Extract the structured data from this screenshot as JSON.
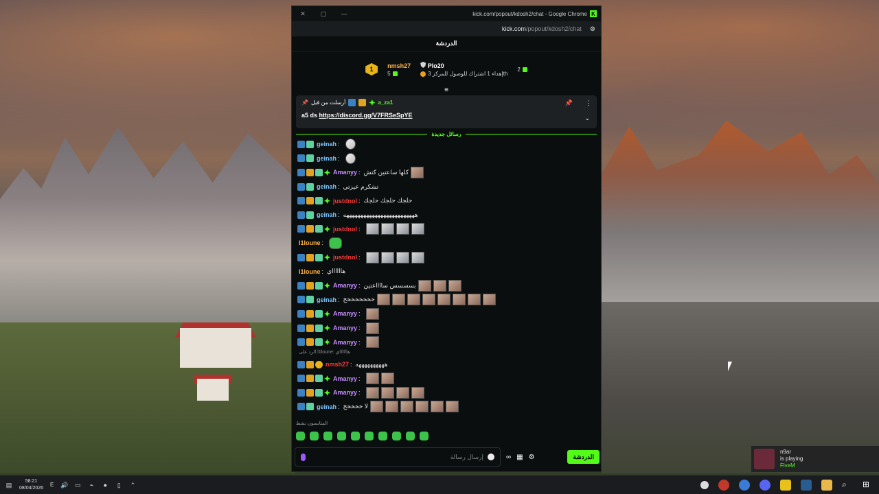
{
  "window": {
    "title": "kick.com/popout/kdosh2/chat - Google Chrome",
    "url_host": "kick.com",
    "url_path": "/popout/kdosh2/chat"
  },
  "chat_header": "الدردشة",
  "leaderboard": {
    "rank": "1",
    "first": {
      "name": "nmsh27",
      "count": "5"
    },
    "second": {
      "name": "Plo20",
      "sub": "إهداء 1 اشتراك للوصول للمركز 3th"
    },
    "right_count": "2"
  },
  "pinned": {
    "label": "أرسلت من قبل",
    "user": "a_za1",
    "text": "a5 ds",
    "link": "https://discord.gg/V7FRSeSpYE"
  },
  "new_messages_label": "رسائل جديدة",
  "messages": [
    {
      "user": "geinah",
      "color": "#7ec8ff",
      "text": ""
    },
    {
      "user": "geinah",
      "color": "#7ec8ff",
      "text": ""
    },
    {
      "user": "Amanyy",
      "color": "#c58cff",
      "text": "كلها ساعتين كتش"
    },
    {
      "user": "geinah",
      "color": "#7ec8ff",
      "text": "تشكرم عيزتي"
    },
    {
      "user": "justdnol",
      "color": "#ff3b3b",
      "text": "حلجك حلجك حلجك"
    },
    {
      "user": "geinah",
      "color": "#7ec8ff",
      "text": "هههههههههههههههههههههههههه"
    },
    {
      "user": "justdnol",
      "color": "#ff3b3b",
      "text": ""
    },
    {
      "user": "l1loune",
      "color": "#ffb347",
      "text": ""
    },
    {
      "user": "justdnol",
      "color": "#ff3b3b",
      "text": ""
    },
    {
      "user": "l1loune",
      "color": "#ffb347",
      "text": "هااااااي"
    },
    {
      "user": "Amanyy",
      "color": "#c58cff",
      "text": "بسسسس سااااعتين"
    },
    {
      "user": "geinah",
      "color": "#7ec8ff",
      "text": "خخخخخخخخ"
    },
    {
      "user": "Amanyy",
      "color": "#c58cff",
      "text": ""
    },
    {
      "user": "Amanyy",
      "color": "#c58cff",
      "text": ""
    },
    {
      "user": "Amanyy",
      "color": "#c58cff",
      "text": ""
    },
    {
      "user": "nmsh27",
      "color": "#ff3b3b",
      "text": "ههههههههههه"
    },
    {
      "user": "Amanyy",
      "color": "#c58cff",
      "text": ""
    },
    {
      "user": "Amanyy",
      "color": "#c58cff",
      "text": ""
    },
    {
      "user": "geinah",
      "color": "#7ec8ff",
      "text": "لا خخخخخ"
    }
  ],
  "reply_preview": "الرد على l1loune: هااااااي",
  "activity": "المثابسون نشط",
  "input_placeholder": "إرسال رسالة",
  "send_label": "الدردشة",
  "taskbar": {
    "time": "58:21",
    "date": "08/04/2026",
    "lang": "E"
  },
  "toast": {
    "name": "n9ar",
    "line1": "is playing",
    "line2": "FiveM"
  },
  "colors": {
    "accent": "#53fc18"
  }
}
